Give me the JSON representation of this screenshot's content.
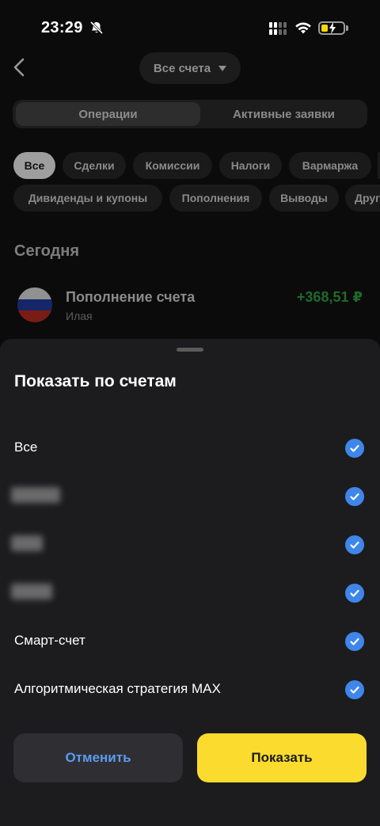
{
  "status_bar": {
    "time": "23:29"
  },
  "header": {
    "account_select_label": "Все счета"
  },
  "tabs": [
    {
      "label": "Операции",
      "active": true
    },
    {
      "label": "Активные заявки",
      "active": false
    }
  ],
  "filters": {
    "row1": [
      "Все",
      "Сделки",
      "Комиссии",
      "Налоги",
      "Вармаржа"
    ],
    "row2": [
      "Дивиденды и купоны",
      "Пополнения",
      "Выводы",
      "Другое"
    ]
  },
  "operations": {
    "section_title": "Сегодня",
    "items": [
      {
        "title": "Пополнение счета",
        "subtitle": "Илая",
        "amount": "+368,51 ₽",
        "icon": "russia-flag-icon"
      }
    ]
  },
  "sheet": {
    "title": "Показать по счетам",
    "options": [
      {
        "label": "Все",
        "checked": true,
        "hidden": false
      },
      {
        "label": "",
        "checked": true,
        "hidden": true
      },
      {
        "label": "",
        "checked": true,
        "hidden": true
      },
      {
        "label": "",
        "checked": true,
        "hidden": true
      },
      {
        "label": "Смарт-счет",
        "checked": true,
        "hidden": false
      },
      {
        "label": "Алгоритмическая стратегия MAX",
        "checked": true,
        "hidden": false
      }
    ],
    "cancel_label": "Отменить",
    "show_label": "Показать"
  },
  "colors": {
    "accent_yellow": "#fbdb2d",
    "check_blue": "#3e86ea",
    "cancel_text": "#5b9bf0",
    "amount_green": "#1f6a2a"
  }
}
